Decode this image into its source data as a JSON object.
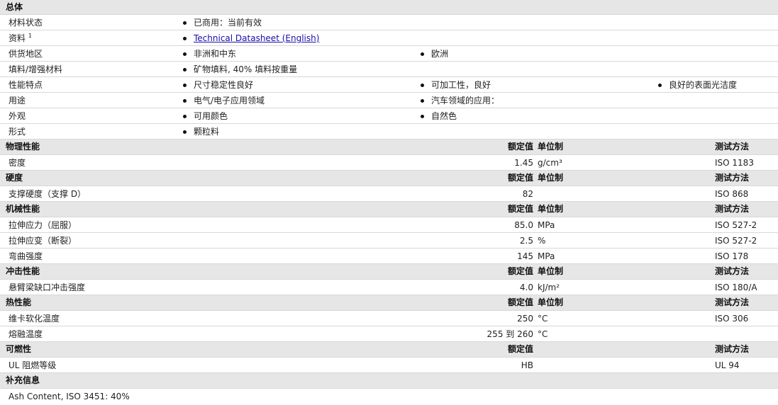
{
  "sections": {
    "general": "总体",
    "physical": "物理性能",
    "hardness": "硬度",
    "mechanical": "机械性能",
    "impact": "冲击性能",
    "thermal": "热性能",
    "flammability": "可燃性",
    "supplementary": "补充信息"
  },
  "headers": {
    "nominal": "额定值",
    "unit": "单位制",
    "method": "测试方法"
  },
  "general": {
    "status_label": "材料状态",
    "status_value": "已商用：当前有效",
    "docs_label": "资料",
    "docs_sup": "1",
    "docs_link": "Technical Datasheet (English)",
    "region_label": "供货地区",
    "region_1": "非洲和中东",
    "region_2": "欧洲",
    "filler_label": "填料/增强材料",
    "filler_1": "矿物填料, 40% 填料按重量",
    "features_label": "性能特点",
    "features_1": "尺寸稳定性良好",
    "features_2": "可加工性，良好",
    "features_3": "良好的表面光洁度",
    "uses_label": "用途",
    "uses_1": "电气/电子应用领域",
    "uses_2": "汽车领域的应用：",
    "appearance_label": "外观",
    "appearance_1": "可用颜色",
    "appearance_2": "自然色",
    "form_label": "形式",
    "form_1": "颗粒料"
  },
  "physical": {
    "density_label": "密度",
    "density_value": "1.45",
    "density_unit": "g/cm³",
    "density_method": "ISO 1183"
  },
  "hardness": {
    "shore_label": "支撑硬度（支撑 D）",
    "shore_value": "82",
    "shore_method": "ISO 868"
  },
  "mechanical": {
    "tensile_stress_label": "拉伸应力（屈服）",
    "tensile_stress_value": "85.0",
    "tensile_stress_unit": "MPa",
    "tensile_stress_method": "ISO 527-2",
    "tensile_strain_label": "拉伸应变（断裂）",
    "tensile_strain_value": "2.5",
    "tensile_strain_unit": "%",
    "tensile_strain_method": "ISO 527-2",
    "flex_label": "弯曲强度",
    "flex_value": "145",
    "flex_unit": "MPa",
    "flex_method": "ISO 178"
  },
  "impact": {
    "izod_label": "悬臂梁缺口冲击强度",
    "izod_value": "4.0",
    "izod_unit": "kJ/m²",
    "izod_method": "ISO 180/A"
  },
  "thermal": {
    "vicat_label": "维卡软化温度",
    "vicat_value": "250",
    "vicat_unit": "°C",
    "vicat_method": "ISO 306",
    "melt_label": "熔融温度",
    "melt_value": "255 到  260",
    "melt_unit": "°C"
  },
  "flammability": {
    "ul_label": "UL 阻燃等级",
    "ul_value": "HB",
    "ul_method": "UL 94"
  },
  "supplementary": {
    "ash": "Ash Content, ISO 3451: 40%"
  }
}
